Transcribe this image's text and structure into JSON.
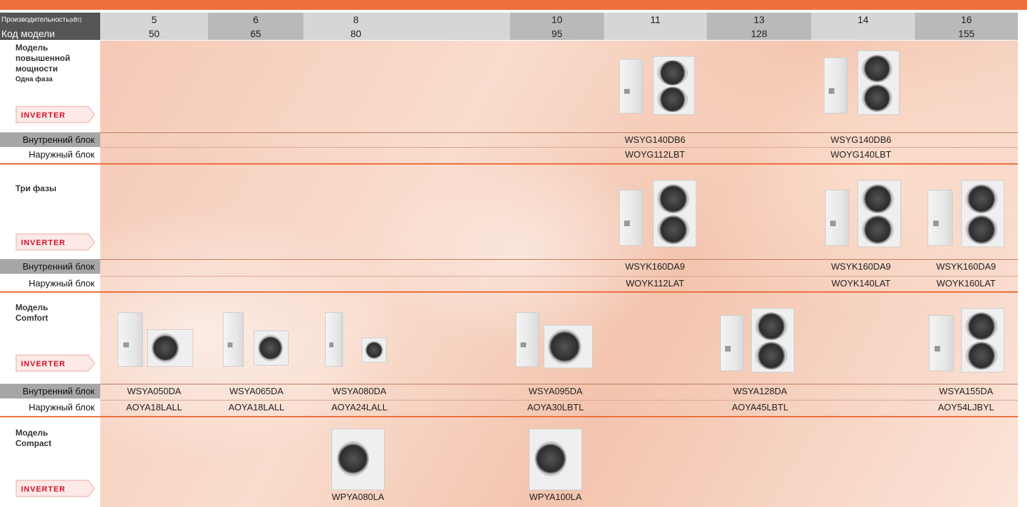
{
  "header": {
    "perf_label": "Производительность",
    "perf_unit": "(кВт)",
    "model_code_label": "Код модели",
    "capacities": [
      "5",
      "6",
      "8",
      "10",
      "11",
      "13",
      "14",
      "16"
    ],
    "codes": [
      "50",
      "65",
      "80",
      "95",
      "",
      "128",
      "",
      "155"
    ]
  },
  "rows": {
    "indoor_label": "Внутренний блок",
    "outdoor_label": "Наружный блок"
  },
  "badge": {
    "text": "INVERTER",
    "color": "#d2102b"
  },
  "colors": {
    "accent": "#ee6e3c"
  },
  "sections": {
    "high": {
      "title_lines": [
        "Модель",
        "повышенной",
        "мощности"
      ],
      "subtitle": "Одна фаза",
      "indoor": [
        "WSYG140DB6",
        "WSYG140DB6"
      ],
      "outdoor": [
        "WOYG112LBT",
        "WOYG140LBT"
      ]
    },
    "three": {
      "title": "Три фазы",
      "indoor": [
        "WSYK160DA9",
        "WSYK160DA9",
        "WSYK160DA9"
      ],
      "outdoor": [
        "WOYK112LAT",
        "WOYK140LAT",
        "WOYK160LAT"
      ]
    },
    "comfort": {
      "title_lines": [
        "Модель",
        "Comfort"
      ],
      "indoor": [
        "WSYA050DA",
        "WSYA065DA",
        "WSYA080DA",
        "WSYA095DA",
        "WSYA128DA",
        "WSYA155DA"
      ],
      "outdoor": [
        "AOYA18LALL",
        "AOYA18LALL",
        "AOYA24LALL",
        "AOYA30LBTL",
        "AOYA45LBTL",
        "AOY54LJBYL"
      ]
    },
    "compact": {
      "title_lines": [
        "Модель",
        "Compact"
      ],
      "units": [
        "WPYA080LA",
        "WPYA100LA"
      ]
    }
  }
}
